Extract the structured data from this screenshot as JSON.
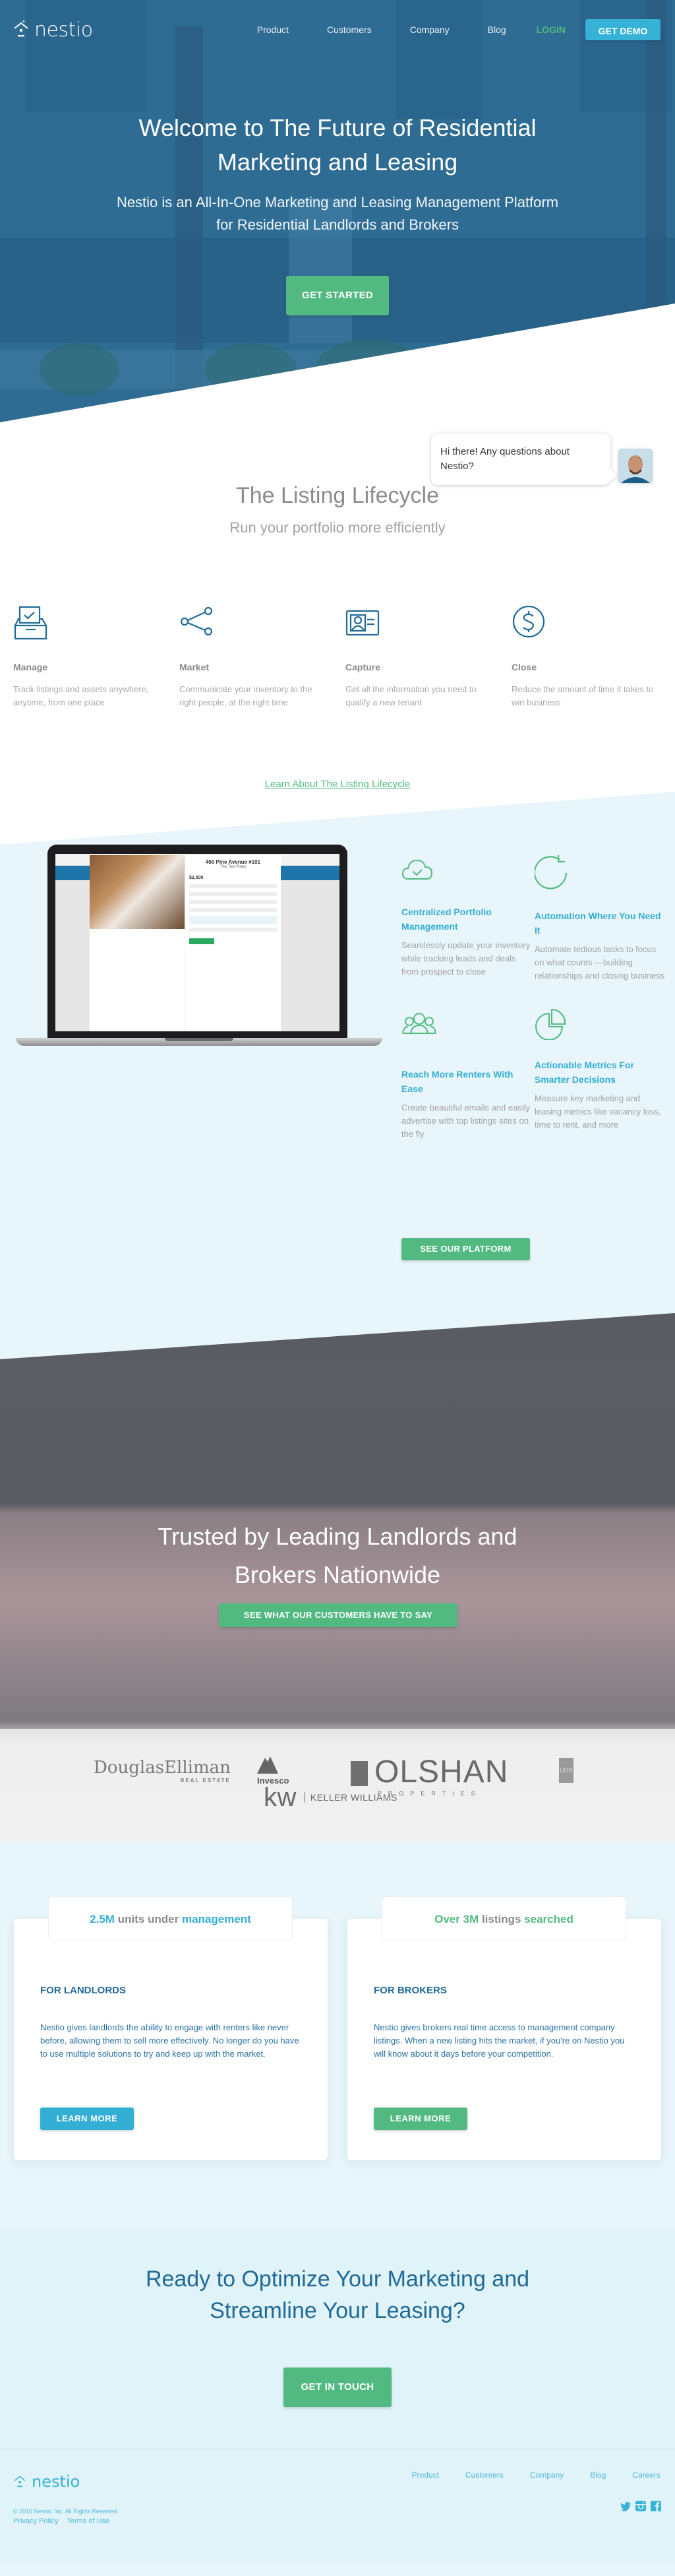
{
  "nav": {
    "brand": "nestio",
    "links": [
      "Product",
      "Customers",
      "Company",
      "Blog"
    ],
    "login": "LOGIN",
    "demo": "GET DEMO"
  },
  "hero": {
    "title": "Welcome to The Future of Residential Marketing and Leasing",
    "subtitle": "Nestio is an All-In-One Marketing and Leasing Management Platform for Residential Landlords and Brokers",
    "cta": "GET STARTED"
  },
  "chat": {
    "message": "Hi there! Any questions about Nestio?"
  },
  "lifecycle": {
    "title": "The Listing Lifecycle",
    "subtitle": "Run your portfolio more efficiently",
    "items": [
      {
        "icon": "inbox-check-icon",
        "title": "Manage",
        "text": "Track listings and assets anywhere, anytime, from one place"
      },
      {
        "icon": "share-icon",
        "title": "Market",
        "text": "Communicate your inventory to the right people, at the right time"
      },
      {
        "icon": "id-card-icon",
        "title": "Capture",
        "text": "Get all the information you need to qualify a new tenant"
      },
      {
        "icon": "dollar-circle-icon",
        "title": "Close",
        "text": "Reduce the amount of time it takes to win business"
      }
    ],
    "link": "Learn About The Listing Lifecycle"
  },
  "platform": {
    "screenshot": {
      "address": "450 Pine Avenue #101",
      "building": "The Two Pines",
      "price": "$2,500"
    },
    "features": [
      {
        "icon": "cloud-check-icon",
        "title": "Centralized Portfolio Management",
        "text": "Seamlessly update your inventory while tracking leads and deals from prospect to close"
      },
      {
        "icon": "refresh-icon",
        "title": "Automation Where You Need It",
        "text": "Automate tedious tasks to focus on what counts —building relationships and closing business"
      },
      {
        "icon": "group-icon",
        "title": "Reach More Renters With Ease",
        "text": "Create beautiful emails and easily advertise with top listings sites on the fly"
      },
      {
        "icon": "pie-chart-icon",
        "title": "Actionable Metrics For Smarter Decisions",
        "text": "Measure key marketing and leasing metrics like vacancy loss, time to rent, and more"
      }
    ],
    "cta": "SEE OUR PLATFORM"
  },
  "trusted": {
    "title": "Trusted by Leading Landlords and Brokers Nationwide",
    "cta": "SEE WHAT OUR CUSTOMERS HAVE TO SAY",
    "logos": {
      "douglas": "DouglasElliman",
      "douglas_sub": "REAL ESTATE",
      "invesco": "Invesco",
      "kw": "kw",
      "kw_name": "KELLER WILLIAMS",
      "olshan": "OLSHAN",
      "olshan_sub": "PROPERTIES",
      "udr": "UDR"
    }
  },
  "audiences": [
    {
      "stat_num": "2.5M",
      "stat_mid": " units under ",
      "stat_end": "management",
      "title": "FOR LANDLORDS",
      "text": "Nestio gives landlords the ability to engage with renters like never before, allowing them to sell more effectively. No longer do you have to use multiple solutions to try and keep up with the market.",
      "cta": "LEARN MORE",
      "accent": "#33aed4"
    },
    {
      "stat_num": "Over 3M",
      "stat_mid": " listings ",
      "stat_end": "searched",
      "title": "FOR BROKERS",
      "text": "Nestio gives brokers real time access to management company listings. When a new listing hits the market, if you're on Nestio you will know about it days before your competition.",
      "cta": "LEARN MORE",
      "accent": "#52ba80"
    }
  ],
  "cta": {
    "title": "Ready to Optimize Your Marketing and Streamline Your Leasing?",
    "button": "GET IN TOUCH"
  },
  "footer": {
    "brand": "nestio",
    "copyright": "© 2016 Nestio, Inc. All Rights Reserved",
    "privacy": "Privacy Policy",
    "terms": "Terms of Use",
    "links": [
      "Product",
      "Customers",
      "Company",
      "Blog",
      "Careers"
    ],
    "social": [
      "twitter-icon",
      "instagram-icon",
      "facebook-icon"
    ]
  },
  "colors": {
    "brand_blue": "#1f6a98",
    "accent_cyan": "#33aed4",
    "accent_green": "#52ba80"
  }
}
